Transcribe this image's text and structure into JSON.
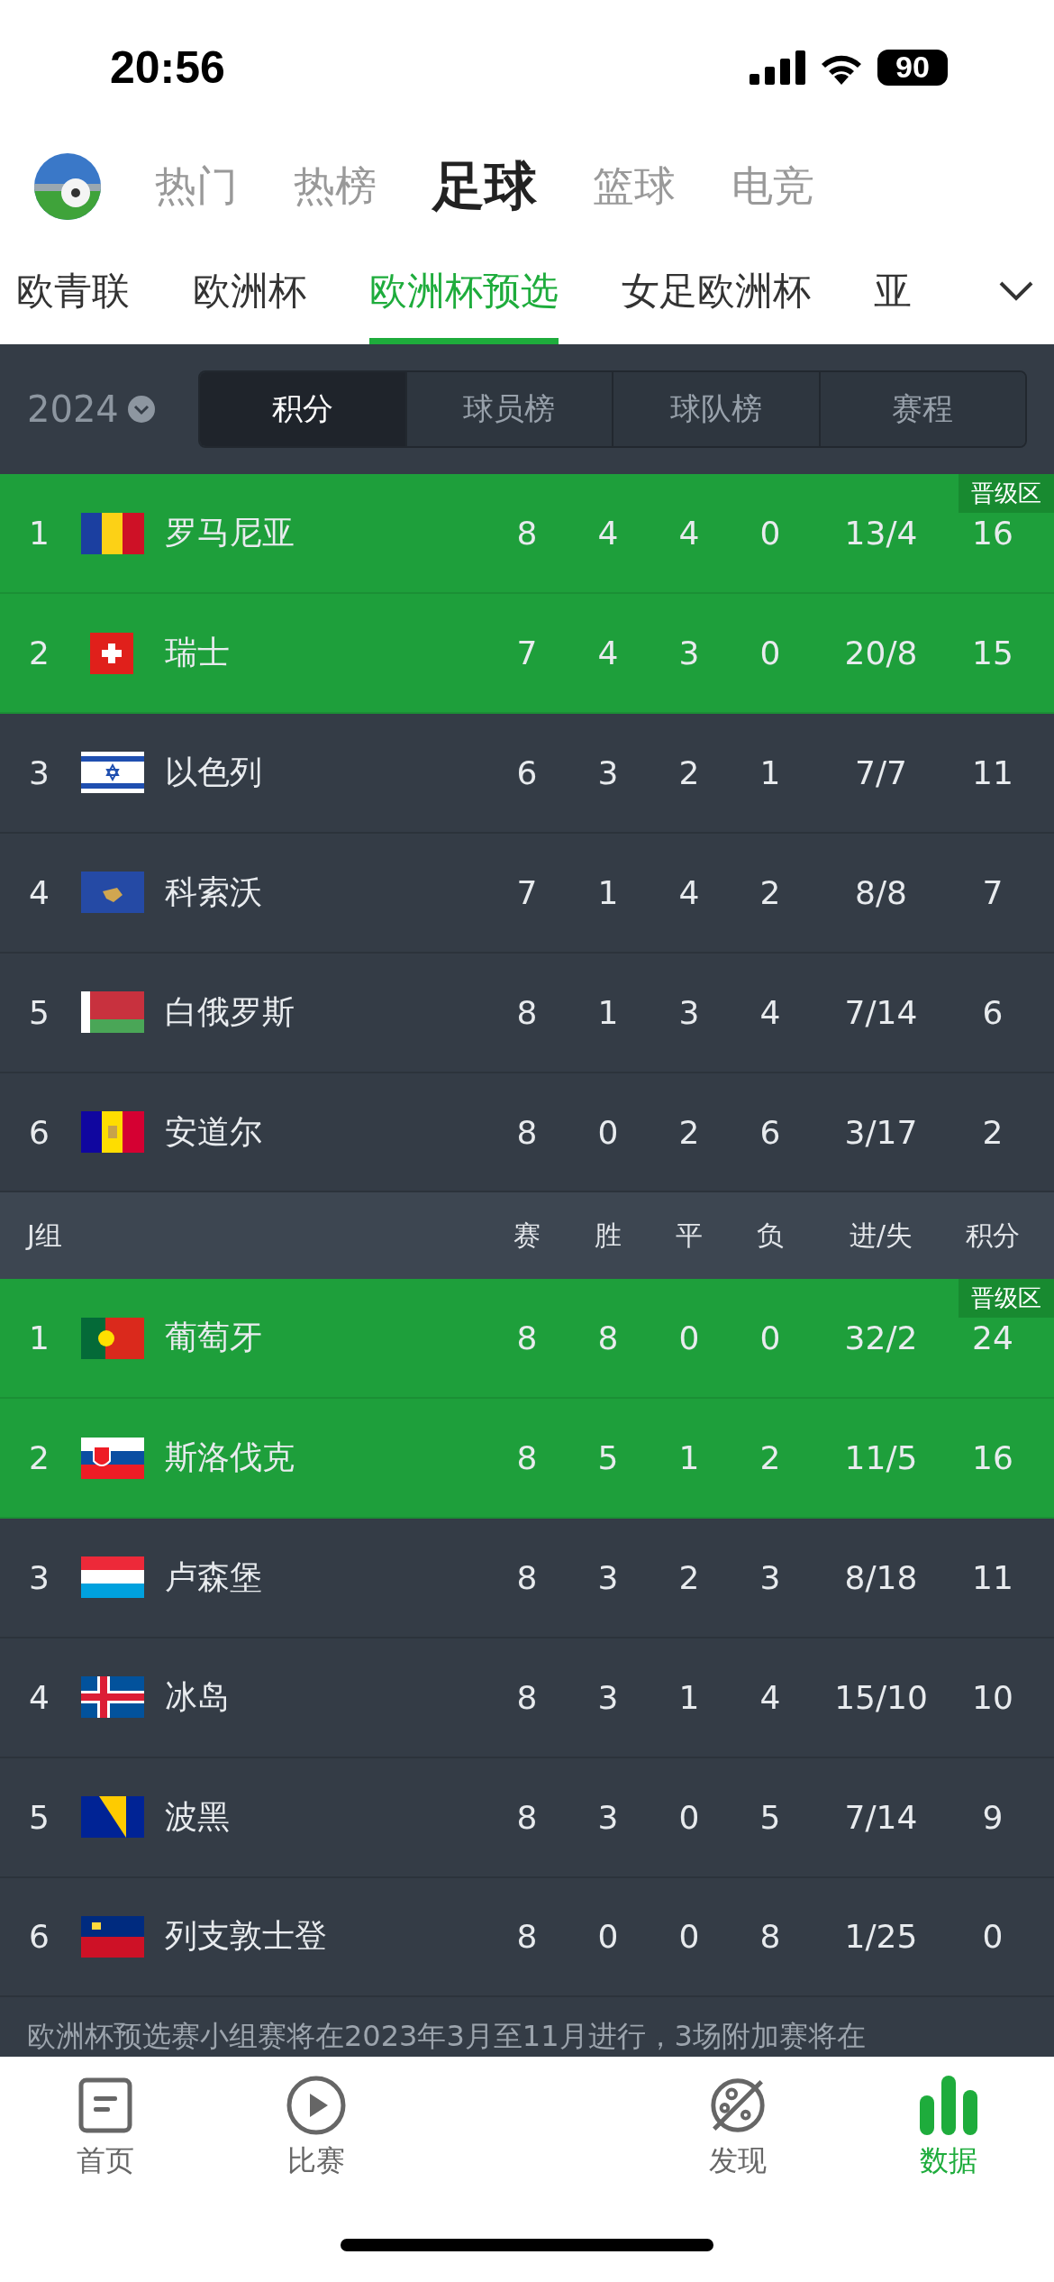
{
  "status_bar": {
    "time": "20:56",
    "battery": "90"
  },
  "top_tabs": [
    {
      "label": "热门",
      "selected": false
    },
    {
      "label": "热榜",
      "selected": false
    },
    {
      "label": "足球",
      "selected": true
    },
    {
      "label": "篮球",
      "selected": false
    },
    {
      "label": "电竞",
      "selected": false
    }
  ],
  "league_tabs": [
    {
      "label": "欧青联",
      "selected": false
    },
    {
      "label": "欧洲杯",
      "selected": false
    },
    {
      "label": "欧洲杯预选",
      "selected": true
    },
    {
      "label": "女足欧洲杯",
      "selected": false
    },
    {
      "label": "亚",
      "selected": false
    }
  ],
  "season": "2024",
  "segments": [
    {
      "label": "积分",
      "selected": true
    },
    {
      "label": "球员榜",
      "selected": false
    },
    {
      "label": "球队榜",
      "selected": false
    },
    {
      "label": "赛程",
      "selected": false
    }
  ],
  "groups": [
    {
      "zone_label": "晋级区",
      "rows": [
        {
          "rank": "1",
          "team": "罗马尼亚",
          "played": "8",
          "won": "4",
          "drawn": "4",
          "lost": "0",
          "goals": "13/4",
          "points": "16",
          "qualified": true
        },
        {
          "rank": "2",
          "team": "瑞士",
          "played": "7",
          "won": "4",
          "drawn": "3",
          "lost": "0",
          "goals": "20/8",
          "points": "15",
          "qualified": true
        },
        {
          "rank": "3",
          "team": "以色列",
          "played": "6",
          "won": "3",
          "drawn": "2",
          "lost": "1",
          "goals": "7/7",
          "points": "11",
          "qualified": false
        },
        {
          "rank": "4",
          "team": "科索沃",
          "played": "7",
          "won": "1",
          "drawn": "4",
          "lost": "2",
          "goals": "8/8",
          "points": "7",
          "qualified": false
        },
        {
          "rank": "5",
          "team": "白俄罗斯",
          "played": "8",
          "won": "1",
          "drawn": "3",
          "lost": "4",
          "goals": "7/14",
          "points": "6",
          "qualified": false
        },
        {
          "rank": "6",
          "team": "安道尔",
          "played": "8",
          "won": "0",
          "drawn": "2",
          "lost": "6",
          "goals": "3/17",
          "points": "2",
          "qualified": false
        }
      ]
    },
    {
      "name": "J组",
      "zone_label": "晋级区",
      "columns": [
        "赛",
        "胜",
        "平",
        "负",
        "进/失",
        "积分"
      ],
      "rows": [
        {
          "rank": "1",
          "team": "葡萄牙",
          "played": "8",
          "won": "8",
          "drawn": "0",
          "lost": "0",
          "goals": "32/2",
          "points": "24",
          "qualified": true
        },
        {
          "rank": "2",
          "team": "斯洛伐克",
          "played": "8",
          "won": "5",
          "drawn": "1",
          "lost": "2",
          "goals": "11/5",
          "points": "16",
          "qualified": true
        },
        {
          "rank": "3",
          "team": "卢森堡",
          "played": "8",
          "won": "3",
          "drawn": "2",
          "lost": "3",
          "goals": "8/18",
          "points": "11",
          "qualified": false
        },
        {
          "rank": "4",
          "team": "冰岛",
          "played": "8",
          "won": "3",
          "drawn": "1",
          "lost": "4",
          "goals": "15/10",
          "points": "10",
          "qualified": false
        },
        {
          "rank": "5",
          "team": "波黑",
          "played": "8",
          "won": "3",
          "drawn": "0",
          "lost": "5",
          "goals": "7/14",
          "points": "9",
          "qualified": false
        },
        {
          "rank": "6",
          "team": "列支敦士登",
          "played": "8",
          "won": "0",
          "drawn": "0",
          "lost": "8",
          "goals": "1/25",
          "points": "0",
          "qualified": false
        }
      ]
    }
  ],
  "note": "欧洲杯预选赛小组赛将在2023年3月至11月进行，3场附加赛将在",
  "bottom_tabs": [
    {
      "label": "首页",
      "kind": "home",
      "selected": false
    },
    {
      "label": "比赛",
      "kind": "match",
      "selected": false
    },
    {
      "label": "发现",
      "kind": "discover",
      "selected": false
    },
    {
      "label": "数据",
      "kind": "data",
      "selected": true
    }
  ]
}
